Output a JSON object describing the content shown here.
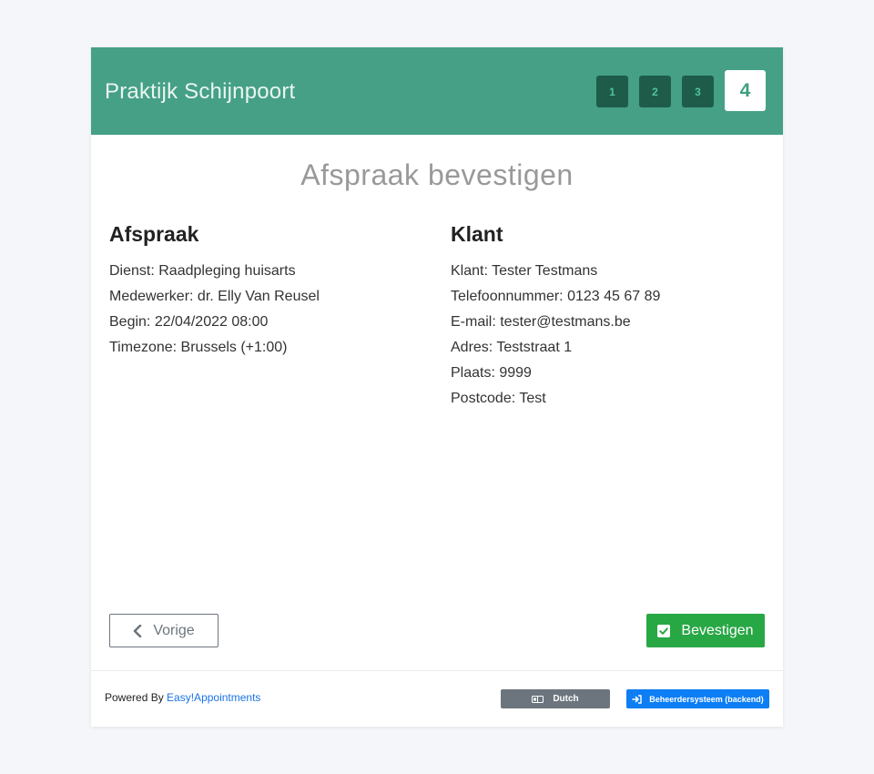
{
  "header": {
    "company_name": "Praktijk Schijnpoort",
    "steps": [
      "1",
      "2",
      "3",
      "4"
    ],
    "active_step": "4"
  },
  "page": {
    "title": "Afspraak bevestigen"
  },
  "appointment": {
    "heading": "Afspraak",
    "service": "Dienst: Raadpleging huisarts",
    "provider": "Medewerker: dr. Elly Van Reusel",
    "start": "Begin: 22/04/2022 08:00",
    "timezone": "Timezone: Brussels (+1:00)"
  },
  "customer": {
    "heading": "Klant",
    "name": "Klant: Tester Testmans",
    "phone": "Telefoonnummer: 0123 45 67 89",
    "email": "E-mail: tester@testmans.be",
    "address": "Adres: Teststraat 1",
    "city": "Plaats: 9999",
    "zip": "Postcode: Test"
  },
  "buttons": {
    "previous": "Vorige",
    "confirm": "Bevestigen"
  },
  "footer": {
    "powered_by": "Powered By",
    "powered_link": "Easy!Appointments",
    "language": "Dutch",
    "backend": "Beheerdersysteem (backend)"
  },
  "colors": {
    "header_bg": "#45a086",
    "step_bg": "#1e5c49",
    "confirm_green": "#28a745",
    "backend_blue": "#0d7ef3",
    "language_gray": "#6c757d"
  },
  "icons": {
    "previous": "chevron-left-icon",
    "confirm": "check-square-icon",
    "language": "language-icon",
    "backend": "sign-in-icon"
  }
}
